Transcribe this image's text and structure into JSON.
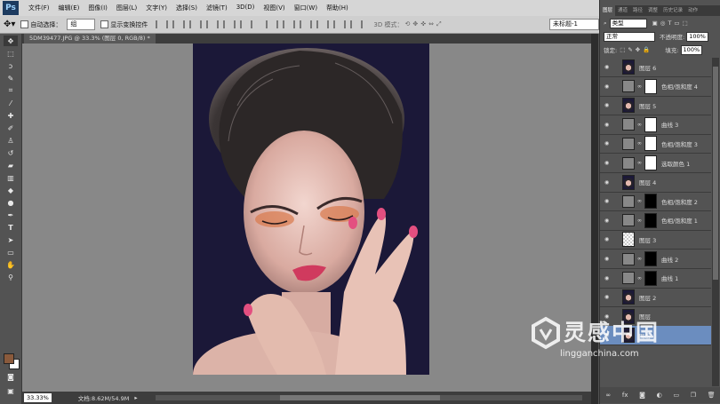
{
  "app": {
    "logo": "Ps"
  },
  "menu": [
    "文件(F)",
    "编辑(E)",
    "图像(I)",
    "图层(L)",
    "文字(Y)",
    "选择(S)",
    "滤镜(T)",
    "3D(D)",
    "视图(V)",
    "窗口(W)",
    "帮助(H)"
  ],
  "window_controls": {
    "minimize": "–",
    "maximize": "□",
    "close": "✕"
  },
  "options": {
    "auto_select_label": "自动选择：",
    "auto_select_value": "组",
    "show_transform_label": "显示变换控件",
    "mode_3d_label": "3D 模式：",
    "workspace": "未标题-1"
  },
  "document": {
    "tab_title": "5DM39477.JPG @ 33.3% (图层 0, RGB/8) *",
    "zoom": "33.33%",
    "doc_size": "文档:8.62M/54.9M"
  },
  "panel": {
    "tabs": [
      "图层",
      "通道",
      "路径",
      "调整",
      "历史记录",
      "动作"
    ],
    "kind_label": "类型",
    "blend_mode": "正常",
    "opacity_label": "不透明度:",
    "opacity_value": "100%",
    "lock_label": "锁定:",
    "fill_label": "填充:",
    "fill_value": "100%",
    "bottom_icons": [
      "link-icon",
      "fx-icon",
      "mask-icon",
      "adjustment-icon",
      "group-icon",
      "new-layer-icon",
      "trash-icon"
    ]
  },
  "layers": [
    {
      "name": "图层 6",
      "kind": "photo",
      "selected": false
    },
    {
      "name": "色相/饱和度 4",
      "kind": "adj",
      "mask": "white",
      "selected": false
    },
    {
      "name": "图层 5",
      "kind": "photo",
      "selected": false
    },
    {
      "name": "曲线 3",
      "kind": "adj",
      "mask": "white",
      "selected": false
    },
    {
      "name": "色相/饱和度 3",
      "kind": "adj",
      "mask": "white",
      "selected": false
    },
    {
      "name": "选取颜色 1",
      "kind": "adj",
      "mask": "white",
      "selected": false
    },
    {
      "name": "图层 4",
      "kind": "photo",
      "selected": false
    },
    {
      "name": "色相/饱和度 2",
      "kind": "adj",
      "mask": "black",
      "selected": false
    },
    {
      "name": "色相/饱和度 1",
      "kind": "adj",
      "mask": "black",
      "selected": false
    },
    {
      "name": "图层 3",
      "kind": "transparent",
      "selected": false
    },
    {
      "name": "曲线 2",
      "kind": "adj",
      "mask": "black",
      "selected": false
    },
    {
      "name": "曲线 1",
      "kind": "adj",
      "mask": "black",
      "selected": false
    },
    {
      "name": "图层 2",
      "kind": "photo",
      "selected": false
    },
    {
      "name": "图层",
      "kind": "photo",
      "selected": false
    },
    {
      "name": "图层",
      "kind": "photo",
      "selected": true
    }
  ],
  "colors": {
    "foreground": "#8a5a3c",
    "background": "#ffffff",
    "selection": "#6b8dbf"
  },
  "watermark": {
    "title": "灵感中国",
    "url": "lingganchina.com"
  }
}
